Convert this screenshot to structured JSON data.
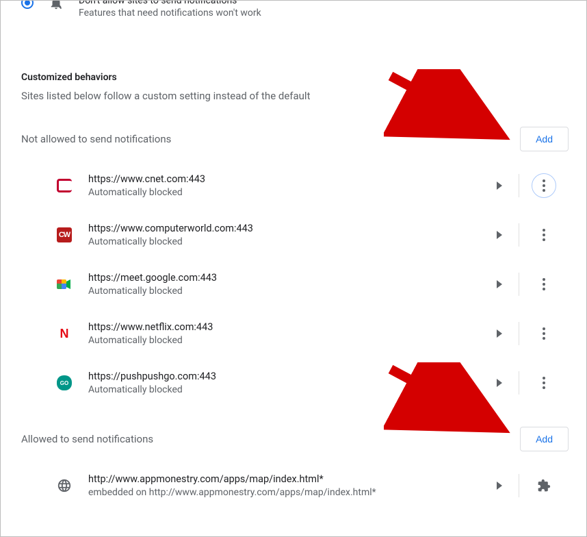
{
  "top_option": {
    "title": "Don't allow sites to send notifications",
    "subtitle": "Features that need notifications won't work"
  },
  "customized": {
    "heading": "Customized behaviors",
    "sub": "Sites listed below follow a custom setting instead of the default"
  },
  "not_allowed": {
    "heading": "Not allowed to send notifications",
    "add_label": "Add",
    "items": [
      {
        "url": "https://www.cnet.com:443",
        "status": "Automatically blocked"
      },
      {
        "url": "https://www.computerworld.com:443",
        "status": "Automatically blocked"
      },
      {
        "url": "https://meet.google.com:443",
        "status": "Automatically blocked"
      },
      {
        "url": "https://www.netflix.com:443",
        "status": "Automatically blocked"
      },
      {
        "url": "https://pushpushgo.com:443",
        "status": "Automatically blocked"
      }
    ]
  },
  "allowed": {
    "heading": "Allowed to send notifications",
    "add_label": "Add",
    "items": [
      {
        "url": "http://www.appmonestry.com/apps/map/index.html*",
        "status": "embedded on http://www.appmonestry.com/apps/map/index.html*"
      }
    ]
  }
}
